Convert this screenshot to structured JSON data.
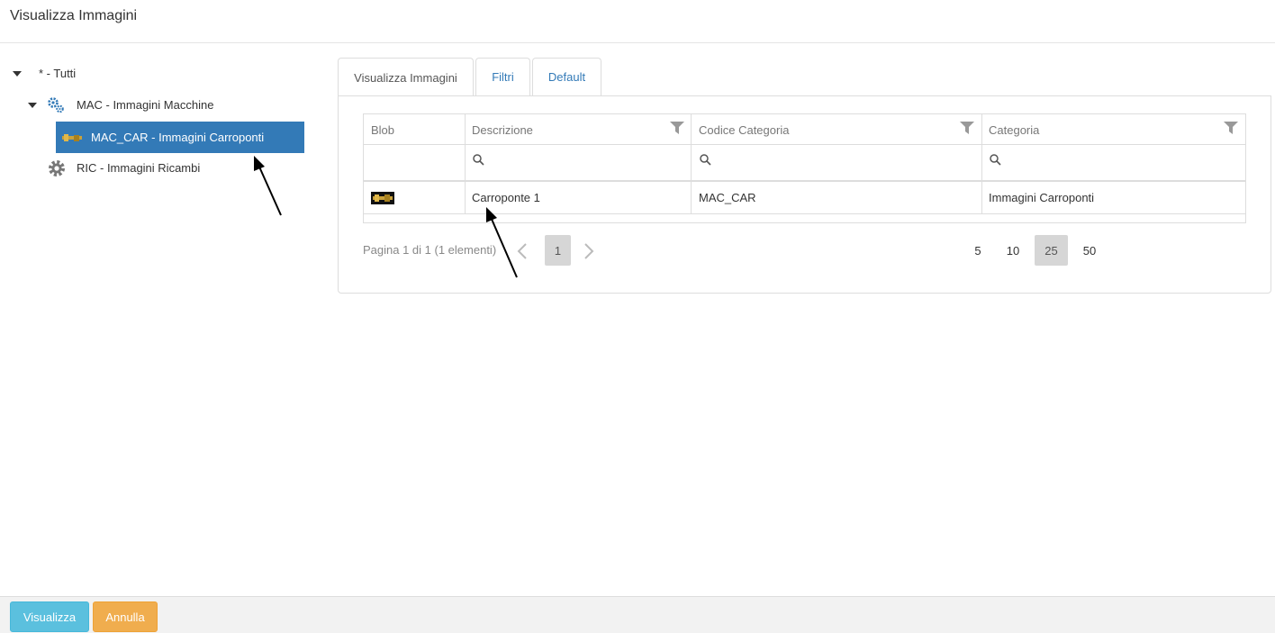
{
  "header": {
    "title": "Visualizza Immagini"
  },
  "tree": {
    "root": {
      "label": "* - Tutti"
    },
    "mac": {
      "label": "MAC - Immagini Macchine"
    },
    "mac_car": {
      "label": "MAC_CAR - Immagini Carroponti"
    },
    "ric": {
      "label": "RIC - Immagini Ricambi"
    }
  },
  "tabs": [
    {
      "label": "Visualizza Immagini"
    },
    {
      "label": "Filtri"
    },
    {
      "label": "Default"
    }
  ],
  "grid": {
    "columns": [
      "Blob",
      "Descrizione",
      "Codice Categoria",
      "Categoria"
    ],
    "rows": [
      {
        "descrizione": "Carroponte 1",
        "codice_categoria": "MAC_CAR",
        "categoria": "Immagini Carroponti"
      }
    ]
  },
  "pager": {
    "info": "Pagina 1 di 1 (1 elementi)",
    "current_page": "1",
    "page_sizes": [
      "5",
      "10",
      "25",
      "50"
    ],
    "selected_page_size": "25"
  },
  "footer": {
    "visualizza_label": "Visualizza",
    "annulla_label": "Annulla"
  },
  "colors": {
    "selected_bg": "#337ab7",
    "info_button": "#5bc0de",
    "warning_button": "#f0ad4e"
  }
}
